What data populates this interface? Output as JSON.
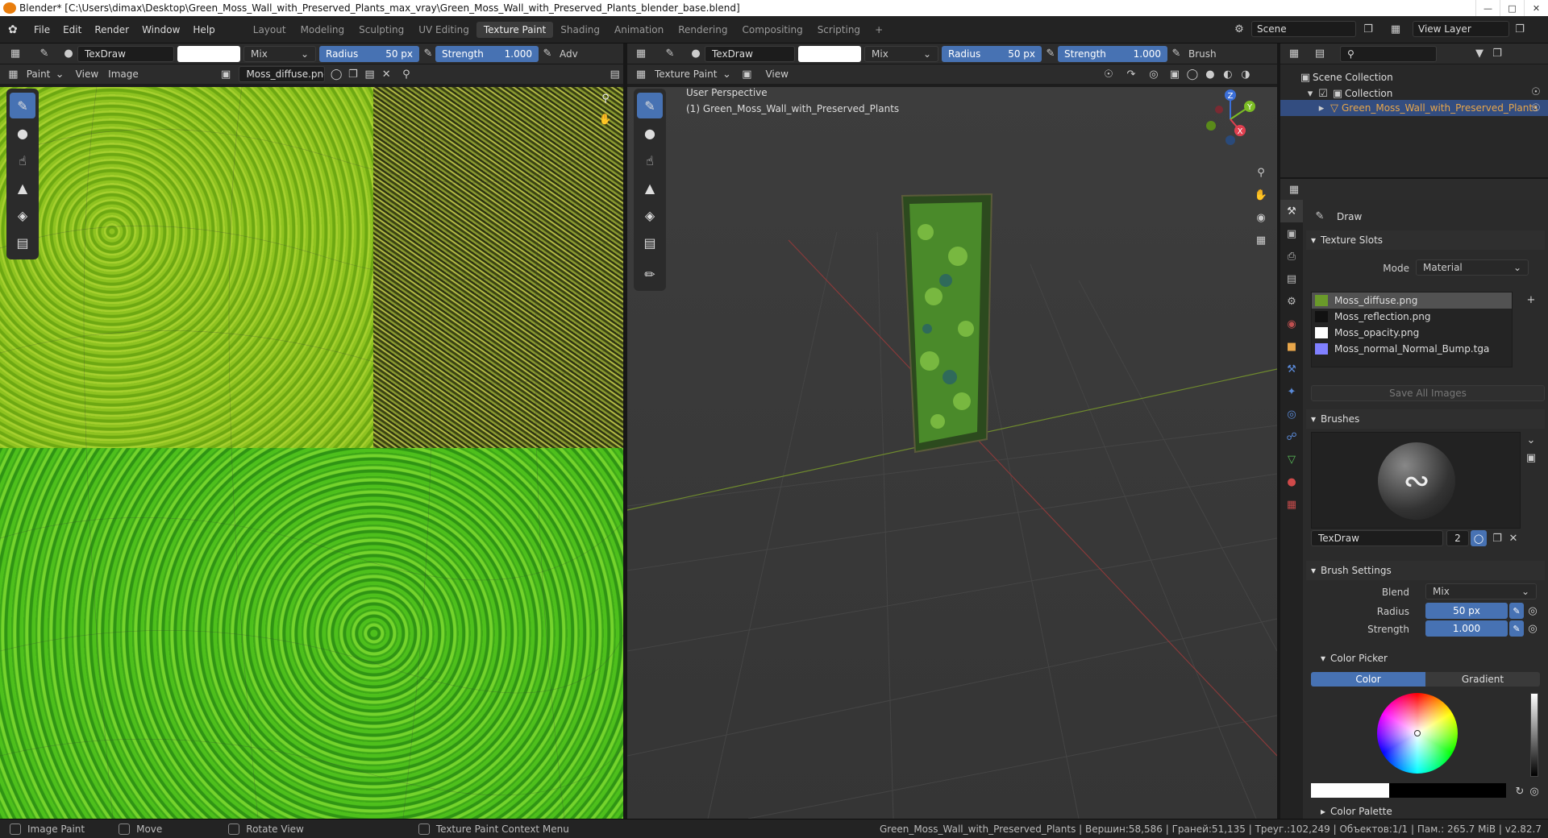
{
  "window": {
    "title": "Blender* [C:\\Users\\dimax\\Desktop\\Green_Moss_Wall_with_Preserved_Plants_max_vray\\Green_Moss_Wall_with_Preserved_Plants_blender_base.blend]"
  },
  "menu": [
    "File",
    "Edit",
    "Render",
    "Window",
    "Help"
  ],
  "workspaces": [
    "Layout",
    "Modeling",
    "Sculpting",
    "UV Editing",
    "Texture Paint",
    "Shading",
    "Animation",
    "Rendering",
    "Compositing",
    "Scripting",
    "+"
  ],
  "active_workspace": "Texture Paint",
  "scene": {
    "name": "Scene",
    "view_layer": "View Layer"
  },
  "left_toolbar": {
    "brush": "TexDraw",
    "blend": "Mix",
    "radius_label": "Radius",
    "radius_value": "50 px",
    "strength_label": "Strength",
    "strength_value": "1.000",
    "adv": "Adv"
  },
  "image_editor": {
    "mode": "Paint",
    "view": "View",
    "image_menu": "Image",
    "image_name": "Moss_diffuse.png"
  },
  "viewport_toolbar": {
    "brush": "TexDraw",
    "blend": "Mix",
    "radius_label": "Radius",
    "radius_value": "50 px",
    "strength_label": "Strength",
    "strength_value": "1.000",
    "brush_menu": "Brush"
  },
  "viewport": {
    "mode": "Texture Paint",
    "view": "View",
    "overlay_title": "User Perspective",
    "overlay_object": "(1) Green_Moss_Wall_with_Preserved_Plants",
    "gizmo": {
      "z": "Z",
      "y": "Y",
      "x": "X"
    }
  },
  "outliner": {
    "scene_collection": "Scene Collection",
    "collection": "Collection",
    "object": "Green_Moss_Wall_with_Preserved_Plants"
  },
  "properties": {
    "tool_name": "Draw",
    "texture_slots_title": "Texture Slots",
    "mode_label": "Mode",
    "mode_value": "Material",
    "slots": [
      {
        "name": "Moss_diffuse.png",
        "color": "#6a9a2a"
      },
      {
        "name": "Moss_reflection.png",
        "color": "#111111"
      },
      {
        "name": "Moss_opacity.png",
        "color": "#ffffff"
      },
      {
        "name": "Moss_normal_Normal_Bump.tga",
        "color": "#8080ff"
      }
    ],
    "save_all": "Save All Images",
    "brushes_title": "Brushes",
    "brush_name": "TexDraw",
    "brush_users": "2",
    "brush_settings_title": "Brush Settings",
    "blend_label": "Blend",
    "blend_value": "Mix",
    "radius_label": "Radius",
    "radius_value": "50 px",
    "strength_label": "Strength",
    "strength_value": "1.000",
    "color_picker_title": "Color Picker",
    "color_tab": "Color",
    "gradient_tab": "Gradient",
    "color_palette_title": "Color Palette"
  },
  "statusbar": {
    "image_paint": "Image Paint",
    "move": "Move",
    "rotate": "Rotate View",
    "context_menu": "Texture Paint Context Menu",
    "stats": "Green_Moss_Wall_with_Preserved_Plants | Вершин:58,586 | Граней:51,135 | Треуг.:102,249 | Объектов:1/1 | Пам.: 265.7 MiB | v2.82.7"
  },
  "colors": {
    "accent": "#4772b3",
    "bg_dark": "#1d1d1d",
    "panel": "#2b2b2b",
    "selected_object": "#e8a64a"
  }
}
